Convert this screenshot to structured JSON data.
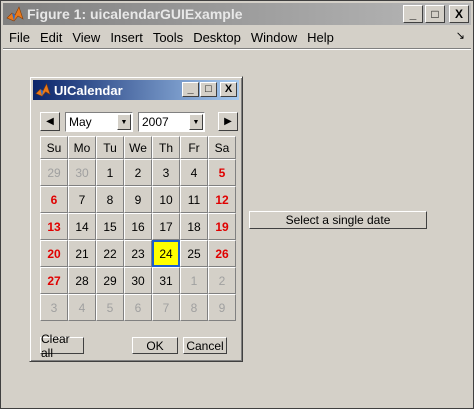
{
  "window": {
    "title": "Figure 1: uicalendarGUIExample",
    "minimize": "_",
    "maximize": "□",
    "close": "X"
  },
  "menu": {
    "items": [
      "File",
      "Edit",
      "View",
      "Insert",
      "Tools",
      "Desktop",
      "Window",
      "Help"
    ],
    "dock_icon": "↘"
  },
  "select_button_label": "Select a single date",
  "calendar": {
    "title": "UICalendar",
    "prev_arrow": "◀",
    "next_arrow": "▶",
    "month": "May",
    "year": "2007",
    "weekdays": [
      "Su",
      "Mo",
      "Tu",
      "We",
      "Th",
      "Fr",
      "Sa"
    ],
    "weeks": [
      [
        "29",
        "30",
        "1",
        "2",
        "3",
        "4",
        "5"
      ],
      [
        "6",
        "7",
        "8",
        "9",
        "10",
        "11",
        "12"
      ],
      [
        "13",
        "14",
        "15",
        "16",
        "17",
        "18",
        "19"
      ],
      [
        "20",
        "21",
        "22",
        "23",
        "24",
        "25",
        "26"
      ],
      [
        "27",
        "28",
        "29",
        "30",
        "31",
        "1",
        "2"
      ],
      [
        "3",
        "4",
        "5",
        "6",
        "7",
        "8",
        "9"
      ]
    ],
    "selected_day": "24",
    "buttons": {
      "clear_all": "Clear all",
      "ok": "OK",
      "cancel": "Cancel"
    }
  },
  "colors": {
    "weekend": "#e00000",
    "selected_fill": "#ffff00",
    "selected_border": "#1c5ecb",
    "other_month": "#a0a0a0"
  }
}
